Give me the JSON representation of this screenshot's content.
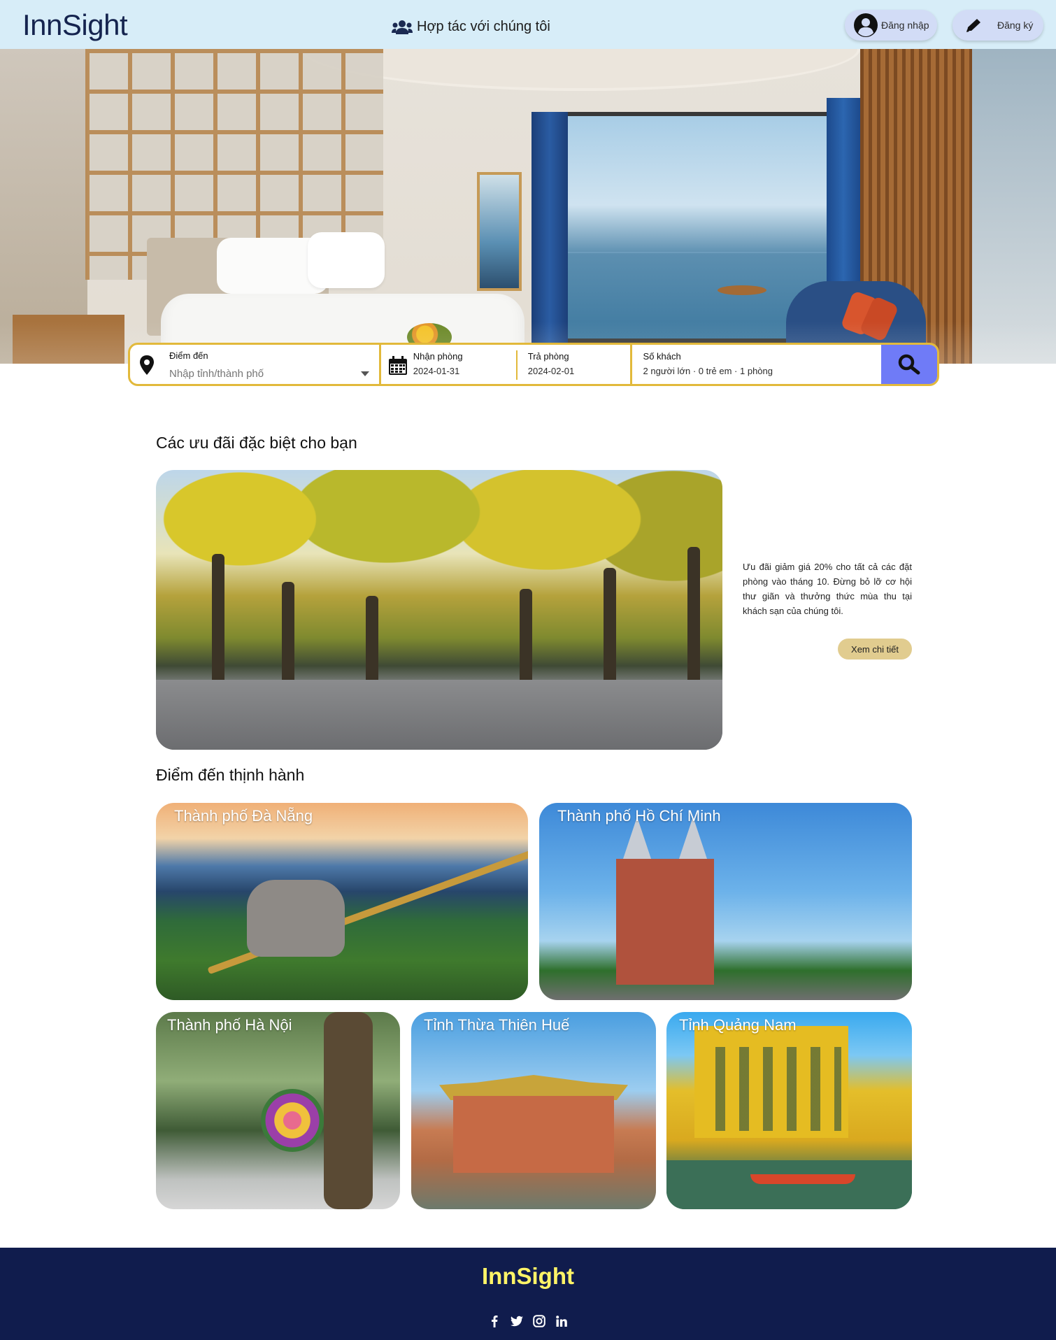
{
  "header": {
    "logo": "InnSight",
    "partner_label": "Hợp tác với chúng tôi",
    "login_label": "Đăng nhập",
    "register_label": "Đăng ký"
  },
  "search": {
    "destination_label": "Điểm đến",
    "destination_placeholder": "Nhập tỉnh/thành phố",
    "checkin_label": "Nhận phòng",
    "checkin_value": "2024-01-31",
    "checkout_label": "Trả phòng",
    "checkout_value": "2024-02-01",
    "guests_label": "Số khách",
    "guests_value": "2 người lớn · 0 trẻ em · 1 phòng"
  },
  "offers": {
    "title": "Các ưu đãi đặc biệt cho bạn",
    "description": "Ưu đãi giảm giá 20% cho tất cả các đặt phòng vào tháng 10. Đừng bỏ lỡ cơ hội thư giãn và thưởng thức mùa thu tại khách sạn của chúng tôi.",
    "button_label": "Xem chi tiết"
  },
  "destinations": {
    "title": "Điểm đến thịnh hành",
    "items": [
      {
        "name": "Thành phố Đà Nẵng"
      },
      {
        "name": "Thành phố Hồ Chí Minh"
      },
      {
        "name": "Thành phố Hà Nội"
      },
      {
        "name": "Tỉnh Thừa Thiên Huế"
      },
      {
        "name": "Tỉnh Quảng Nam"
      }
    ]
  },
  "footer": {
    "logo": "InnSight",
    "socials": [
      "facebook-icon",
      "twitter-icon",
      "instagram-icon",
      "linkedin-icon"
    ]
  },
  "colors": {
    "header_bg": "#d7edf8",
    "logo": "#15244f",
    "search_border": "#e2b93b",
    "search_button": "#6f7bf7",
    "detail_button": "#e1cc8f",
    "footer_bg": "#101c4d",
    "footer_logo": "#fff467"
  }
}
